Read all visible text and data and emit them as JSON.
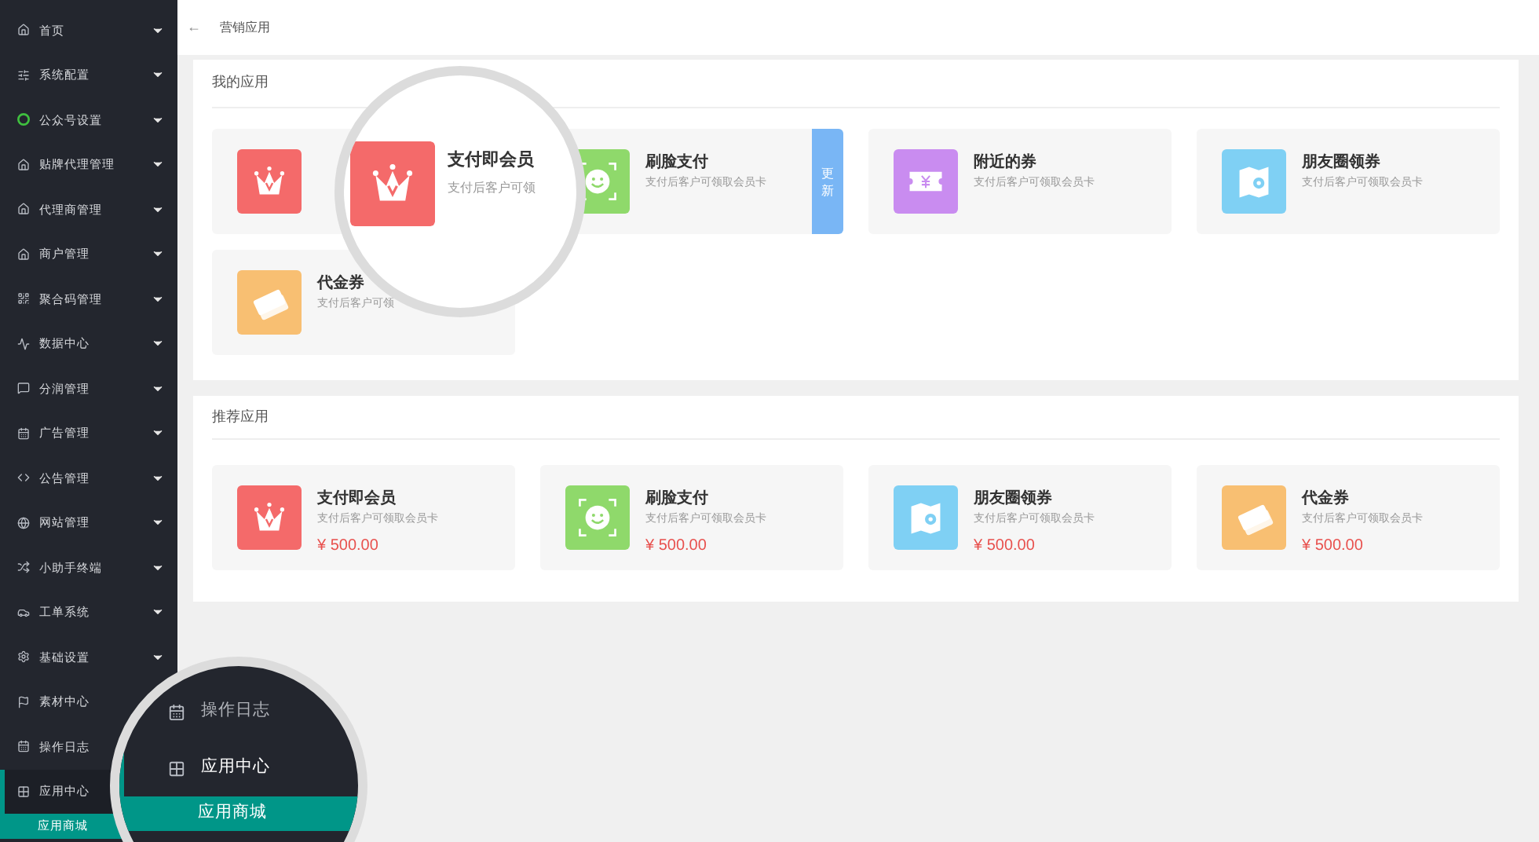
{
  "sidebar": {
    "items": [
      {
        "label": "首页",
        "kind": "home",
        "has_arrow": true,
        "selected": false
      },
      {
        "label": "系统配置",
        "kind": "sliders",
        "has_arrow": true,
        "selected": false
      },
      {
        "label": "公众号设置",
        "kind": "ring",
        "has_arrow": true,
        "selected": false
      },
      {
        "label": "贴牌代理管理",
        "kind": "home",
        "has_arrow": true,
        "selected": false
      },
      {
        "label": "代理商管理",
        "kind": "home",
        "has_arrow": true,
        "selected": false
      },
      {
        "label": "商户管理",
        "kind": "home",
        "has_arrow": true,
        "selected": false
      },
      {
        "label": "聚合码管理",
        "kind": "qr",
        "has_arrow": true,
        "selected": false
      },
      {
        "label": "数据中心",
        "kind": "pulse",
        "has_arrow": true,
        "selected": false
      },
      {
        "label": "分润管理",
        "kind": "chat",
        "has_arrow": true,
        "selected": false
      },
      {
        "label": "广告管理",
        "kind": "calendar",
        "has_arrow": true,
        "selected": false
      },
      {
        "label": "公告管理",
        "kind": "code",
        "has_arrow": true,
        "selected": false
      },
      {
        "label": "网站管理",
        "kind": "globe",
        "has_arrow": true,
        "selected": false
      },
      {
        "label": "小助手终端",
        "kind": "shuffle",
        "has_arrow": true,
        "selected": false
      },
      {
        "label": "工单系统",
        "kind": "car",
        "has_arrow": true,
        "selected": false
      },
      {
        "label": "基础设置",
        "kind": "gear",
        "has_arrow": true,
        "selected": false
      },
      {
        "label": "素材中心",
        "kind": "flag",
        "selected": false
      },
      {
        "label": "操作日志",
        "kind": "calendar",
        "selected": false
      },
      {
        "label": "应用中心",
        "kind": "grid",
        "has_arrow": false,
        "selected": true,
        "children": [
          {
            "label": "应用商城",
            "selected": true
          }
        ]
      }
    ]
  },
  "header": {
    "back": "←",
    "title": "营销应用"
  },
  "my_apps": {
    "title": "我的应用",
    "items": [
      {
        "kind": "crown",
        "color": "#f46a6a"
      },
      {
        "title": "刷脸支付",
        "desc": "支付后客户可领取会员卡",
        "kind": "face",
        "color": "#8fd96b",
        "badge": "更新"
      },
      {
        "title": "附近的券",
        "desc": "支付后客户可领取会员卡",
        "kind": "ticket",
        "color": "#c98cf0"
      },
      {
        "title": "朋友圈领券",
        "desc": "支付后客户可领取会员卡",
        "kind": "map",
        "color": "#7fd0f4"
      },
      {
        "title": "代金券",
        "desc": "支付后客户可领",
        "kind": "coupon",
        "color": "#f8bf72"
      }
    ]
  },
  "recommended": {
    "title": "推荐应用",
    "items": [
      {
        "title": "支付即会员",
        "desc": "支付后客户可领取会员卡",
        "price": "¥ 500.00",
        "kind": "crown",
        "color": "#f46a6a"
      },
      {
        "title": "刷脸支付",
        "desc": "支付后客户可领取会员卡",
        "price": "¥ 500.00",
        "kind": "face",
        "color": "#8fd96b"
      },
      {
        "title": "朋友圈领券",
        "desc": "支付后客户可领取会员卡",
        "price": "¥ 500.00",
        "kind": "map",
        "color": "#7fd0f4"
      },
      {
        "title": "代金券",
        "desc": "支付后客户可领取会员卡",
        "price": "¥ 500.00",
        "kind": "coupon",
        "color": "#f8bf72"
      }
    ]
  },
  "lens_apps": {
    "title": "支付即会员",
    "desc": "支付后客户可领",
    "kind": "crown",
    "color": "#f46a6a"
  },
  "lens_menu": {
    "items": [
      {
        "label": "操作日志",
        "kind": "calendar",
        "selected": false
      },
      {
        "label": "应用中心",
        "kind": "grid",
        "selected": true
      },
      {
        "label": "应用商城",
        "kind": "none",
        "selected": true
      }
    ]
  }
}
